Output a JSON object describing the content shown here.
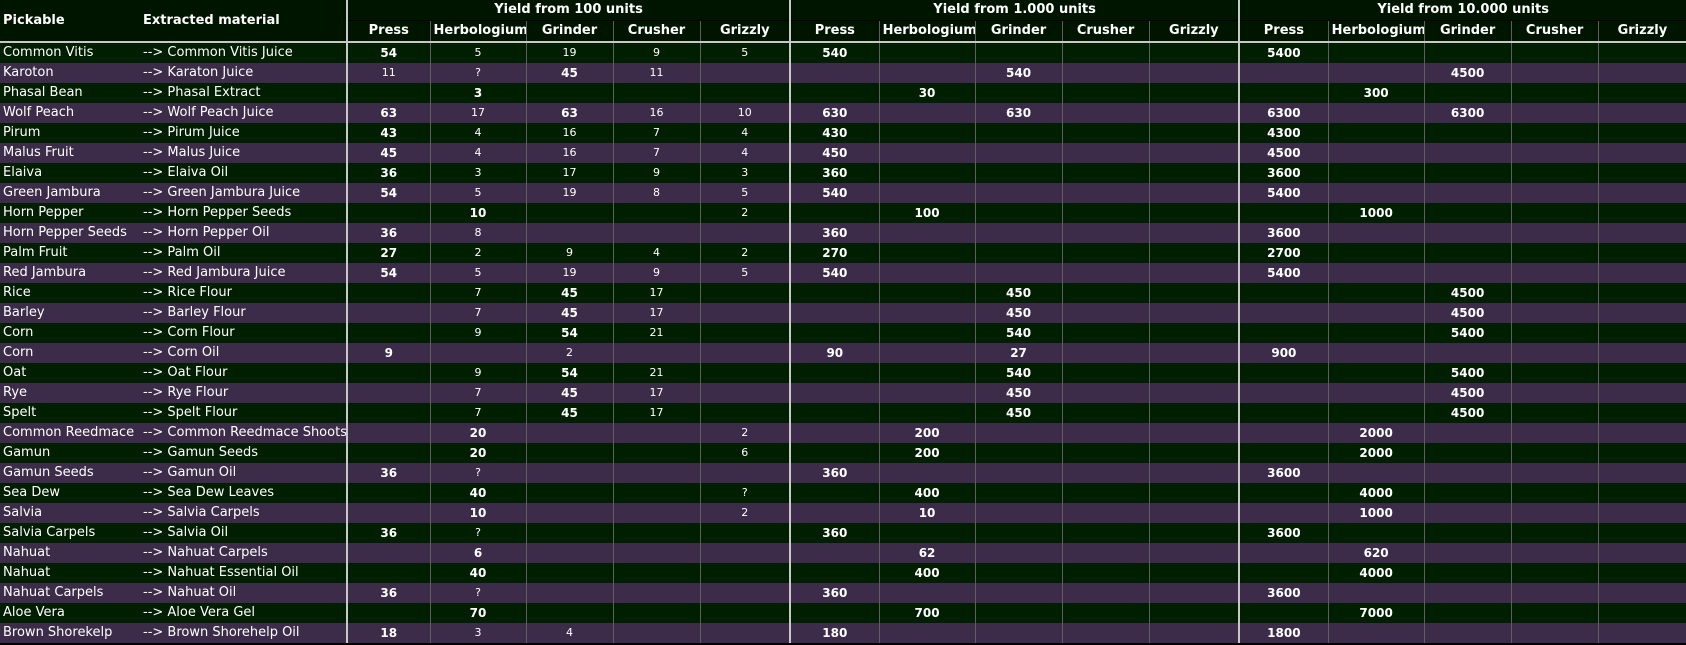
{
  "headers": {
    "pickable": "Pickable",
    "extracted": "Extracted material",
    "groups": [
      "Yield from 100 units",
      "Yield from 1.000 units",
      "Yield from 10.000 units"
    ],
    "tools": [
      "Press",
      "Herbologium",
      "Grinder",
      "Crusher",
      "Grizzly"
    ]
  },
  "rows": [
    {
      "p": "Common Vitis",
      "m": "--> Common Vitis Juice",
      "y100": [
        "54",
        "5",
        "19",
        "9",
        "5"
      ],
      "y1k": [
        "540",
        "",
        "",
        "",
        ""
      ],
      "y10k": [
        "5400",
        "",
        "",
        "",
        ""
      ],
      "bold": [
        0
      ]
    },
    {
      "p": "Karoton",
      "m": "--> Karaton Juice",
      "y100": [
        "11",
        "?",
        "45",
        "11",
        ""
      ],
      "y1k": [
        "",
        "",
        "540",
        "",
        ""
      ],
      "y10k": [
        "",
        "",
        "4500",
        "",
        ""
      ],
      "bold": [
        2
      ]
    },
    {
      "p": "Phasal Bean",
      "m": "--> Phasal Extract",
      "y100": [
        "",
        "3",
        "",
        "",
        ""
      ],
      "y1k": [
        "",
        "30",
        "",
        "",
        ""
      ],
      "y10k": [
        "",
        "300",
        "",
        "",
        ""
      ],
      "bold": [
        1
      ]
    },
    {
      "p": "Wolf Peach",
      "m": "--> Wolf Peach Juice",
      "y100": [
        "63",
        "17",
        "63",
        "16",
        "10"
      ],
      "y1k": [
        "630",
        "",
        "630",
        "",
        ""
      ],
      "y10k": [
        "6300",
        "",
        "6300",
        "",
        ""
      ],
      "bold": [
        0,
        2
      ]
    },
    {
      "p": "Pirum",
      "m": "--> Pirum Juice",
      "y100": [
        "43",
        "4",
        "16",
        "7",
        "4"
      ],
      "y1k": [
        "430",
        "",
        "",
        "",
        ""
      ],
      "y10k": [
        "4300",
        "",
        "",
        "",
        ""
      ],
      "bold": [
        0
      ]
    },
    {
      "p": "Malus Fruit",
      "m": "--> Malus Juice",
      "y100": [
        "45",
        "4",
        "16",
        "7",
        "4"
      ],
      "y1k": [
        "450",
        "",
        "",
        "",
        ""
      ],
      "y10k": [
        "4500",
        "",
        "",
        "",
        ""
      ],
      "bold": [
        0
      ]
    },
    {
      "p": "Elaiva",
      "m": "--> Elaiva Oil",
      "y100": [
        "36",
        "3",
        "17",
        "9",
        "3"
      ],
      "y1k": [
        "360",
        "",
        "",
        "",
        ""
      ],
      "y10k": [
        "3600",
        "",
        "",
        "",
        ""
      ],
      "bold": [
        0
      ]
    },
    {
      "p": "Green Jambura",
      "m": "--> Green Jambura Juice",
      "y100": [
        "54",
        "5",
        "19",
        "8",
        "5"
      ],
      "y1k": [
        "540",
        "",
        "",
        "",
        ""
      ],
      "y10k": [
        "5400",
        "",
        "",
        "",
        ""
      ],
      "bold": [
        0
      ]
    },
    {
      "p": "Horn Pepper",
      "m": "--> Horn Pepper Seeds",
      "y100": [
        "",
        "10",
        "",
        "",
        "2"
      ],
      "y1k": [
        "",
        "100",
        "",
        "",
        ""
      ],
      "y10k": [
        "",
        "1000",
        "",
        "",
        ""
      ],
      "bold": [
        1
      ]
    },
    {
      "p": "Horn Pepper Seeds",
      "m": "--> Horn Pepper Oil",
      "y100": [
        "36",
        "8",
        "",
        "",
        ""
      ],
      "y1k": [
        "360",
        "",
        "",
        "",
        ""
      ],
      "y10k": [
        "3600",
        "",
        "",
        "",
        ""
      ],
      "bold": [
        0
      ]
    },
    {
      "p": "Palm Fruit",
      "m": "--> Palm Oil",
      "y100": [
        "27",
        "2",
        "9",
        "4",
        "2"
      ],
      "y1k": [
        "270",
        "",
        "",
        "",
        ""
      ],
      "y10k": [
        "2700",
        "",
        "",
        "",
        ""
      ],
      "bold": [
        0
      ]
    },
    {
      "p": "Red Jambura",
      "m": "--> Red Jambura Juice",
      "y100": [
        "54",
        "5",
        "19",
        "9",
        "5"
      ],
      "y1k": [
        "540",
        "",
        "",
        "",
        ""
      ],
      "y10k": [
        "5400",
        "",
        "",
        "",
        ""
      ],
      "bold": [
        0
      ]
    },
    {
      "p": "Rice",
      "m": "--> Rice Flour",
      "y100": [
        "",
        "7",
        "45",
        "17",
        ""
      ],
      "y1k": [
        "",
        "",
        "450",
        "",
        ""
      ],
      "y10k": [
        "",
        "",
        "4500",
        "",
        ""
      ],
      "bold": [
        2
      ]
    },
    {
      "p": "Barley",
      "m": "--> Barley Flour",
      "y100": [
        "",
        "7",
        "45",
        "17",
        ""
      ],
      "y1k": [
        "",
        "",
        "450",
        "",
        ""
      ],
      "y10k": [
        "",
        "",
        "4500",
        "",
        ""
      ],
      "bold": [
        2
      ]
    },
    {
      "p": "Corn",
      "m": "--> Corn Flour",
      "y100": [
        "",
        "9",
        "54",
        "21",
        ""
      ],
      "y1k": [
        "",
        "",
        "540",
        "",
        ""
      ],
      "y10k": [
        "",
        "",
        "5400",
        "",
        ""
      ],
      "bold": [
        2
      ]
    },
    {
      "p": "Corn",
      "m": "--> Corn Oil",
      "y100": [
        "9",
        "",
        "2",
        "",
        ""
      ],
      "y1k": [
        "90",
        "",
        "27",
        "",
        ""
      ],
      "y10k": [
        "900",
        "",
        "",
        "",
        ""
      ],
      "bold": [
        0
      ]
    },
    {
      "p": "Oat",
      "m": "--> Oat Flour",
      "y100": [
        "",
        "9",
        "54",
        "21",
        ""
      ],
      "y1k": [
        "",
        "",
        "540",
        "",
        ""
      ],
      "y10k": [
        "",
        "",
        "5400",
        "",
        ""
      ],
      "bold": [
        2
      ]
    },
    {
      "p": "Rye",
      "m": "--> Rye Flour",
      "y100": [
        "",
        "7",
        "45",
        "17",
        ""
      ],
      "y1k": [
        "",
        "",
        "450",
        "",
        ""
      ],
      "y10k": [
        "",
        "",
        "4500",
        "",
        ""
      ],
      "bold": [
        2
      ]
    },
    {
      "p": "Spelt",
      "m": "--> Spelt Flour",
      "y100": [
        "",
        "7",
        "45",
        "17",
        ""
      ],
      "y1k": [
        "",
        "",
        "450",
        "",
        ""
      ],
      "y10k": [
        "",
        "",
        "4500",
        "",
        ""
      ],
      "bold": [
        2
      ]
    },
    {
      "p": "Common Reedmace",
      "m": "--> Common Reedmace Shoots",
      "y100": [
        "",
        "20",
        "",
        "",
        "2"
      ],
      "y1k": [
        "",
        "200",
        "",
        "",
        ""
      ],
      "y10k": [
        "",
        "2000",
        "",
        "",
        ""
      ],
      "bold": [
        1
      ]
    },
    {
      "p": "Gamun",
      "m": "--> Gamun Seeds",
      "y100": [
        "",
        "20",
        "",
        "",
        "6"
      ],
      "y1k": [
        "",
        "200",
        "",
        "",
        ""
      ],
      "y10k": [
        "",
        "2000",
        "",
        "",
        ""
      ],
      "bold": [
        1
      ]
    },
    {
      "p": "Gamun Seeds",
      "m": "--> Gamun Oil",
      "y100": [
        "36",
        "?",
        "",
        "",
        ""
      ],
      "y1k": [
        "360",
        "",
        "",
        "",
        ""
      ],
      "y10k": [
        "3600",
        "",
        "",
        "",
        ""
      ],
      "bold": [
        0
      ]
    },
    {
      "p": "Sea Dew",
      "m": "--> Sea Dew Leaves",
      "y100": [
        "",
        "40",
        "",
        "",
        "?"
      ],
      "y1k": [
        "",
        "400",
        "",
        "",
        ""
      ],
      "y10k": [
        "",
        "4000",
        "",
        "",
        ""
      ],
      "bold": [
        1
      ]
    },
    {
      "p": "Salvia",
      "m": "--> Salvia Carpels",
      "y100": [
        "",
        "10",
        "",
        "",
        "2"
      ],
      "y1k": [
        "",
        "10",
        "",
        "",
        ""
      ],
      "y10k": [
        "",
        "1000",
        "",
        "",
        ""
      ],
      "bold": [
        1
      ]
    },
    {
      "p": "Salvia Carpels",
      "m": "--> Salvia Oil",
      "y100": [
        "36",
        "?",
        "",
        "",
        ""
      ],
      "y1k": [
        "360",
        "",
        "",
        "",
        ""
      ],
      "y10k": [
        "3600",
        "",
        "",
        "",
        ""
      ],
      "bold": [
        0
      ]
    },
    {
      "p": "Nahuat",
      "m": "--> Nahuat Carpels",
      "y100": [
        "",
        "6",
        "",
        "",
        ""
      ],
      "y1k": [
        "",
        "62",
        "",
        "",
        ""
      ],
      "y10k": [
        "",
        "620",
        "",
        "",
        ""
      ],
      "bold": [
        1
      ]
    },
    {
      "p": "Nahuat",
      "m": "--> Nahuat Essential Oil",
      "y100": [
        "",
        "40",
        "",
        "",
        ""
      ],
      "y1k": [
        "",
        "400",
        "",
        "",
        ""
      ],
      "y10k": [
        "",
        "4000",
        "",
        "",
        ""
      ],
      "bold": [
        1
      ]
    },
    {
      "p": "Nahuat Carpels",
      "m": "--> Nahuat Oil",
      "y100": [
        "36",
        "?",
        "",
        "",
        ""
      ],
      "y1k": [
        "360",
        "",
        "",
        "",
        ""
      ],
      "y10k": [
        "3600",
        "",
        "",
        "",
        ""
      ],
      "bold": [
        0
      ]
    },
    {
      "p": "Aloe Vera",
      "m": "--> Aloe Vera Gel",
      "y100": [
        "",
        "70",
        "",
        "",
        ""
      ],
      "y1k": [
        "",
        "700",
        "",
        "",
        ""
      ],
      "y10k": [
        "",
        "7000",
        "",
        "",
        ""
      ],
      "bold": [
        1
      ]
    },
    {
      "p": "Brown Shorekelp",
      "m": "--> Brown Shorehelp Oil",
      "y100": [
        "18",
        "3",
        "4",
        "",
        ""
      ],
      "y1k": [
        "180",
        "",
        "",
        "",
        ""
      ],
      "y10k": [
        "1800",
        "",
        "",
        "",
        ""
      ],
      "bold": [
        0
      ]
    }
  ]
}
